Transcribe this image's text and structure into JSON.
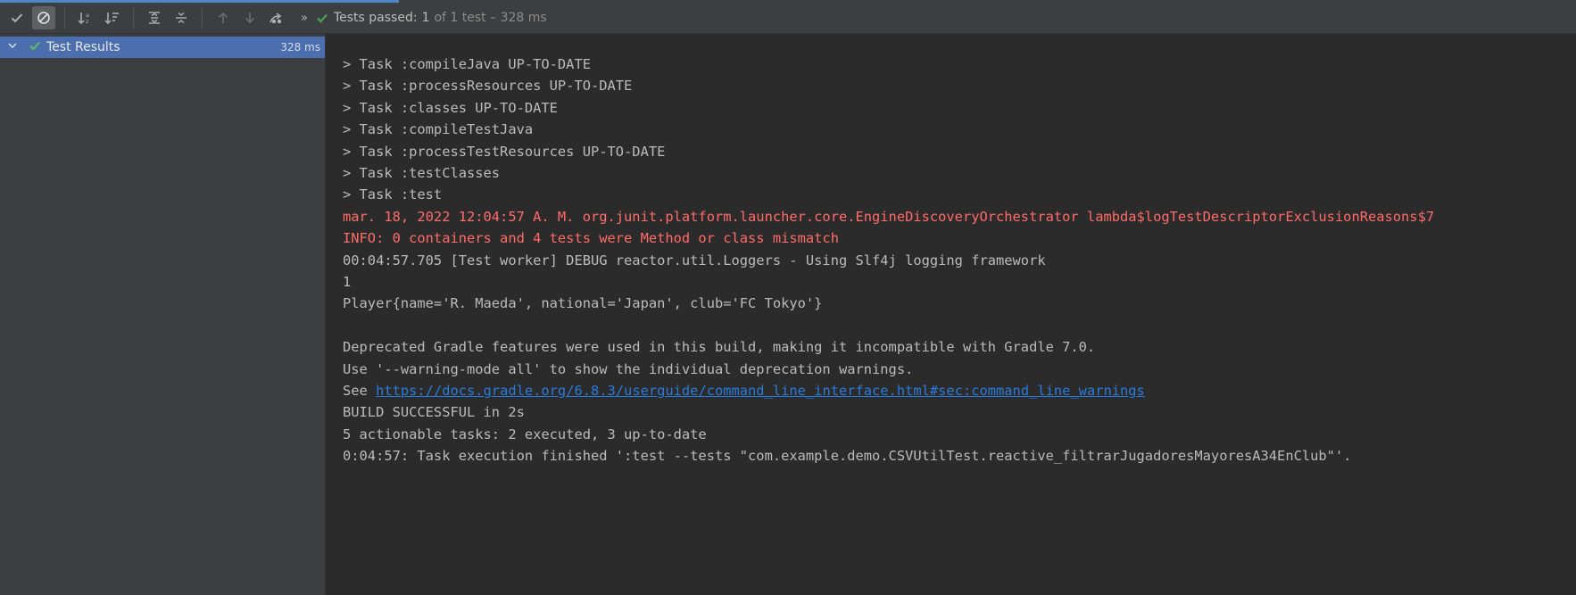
{
  "progress": {
    "fraction": 0.253
  },
  "toolbar": {
    "buttons": [
      {
        "icon": "show-passed-icon",
        "active": false
      },
      {
        "icon": "show-ignored-icon",
        "active": true
      },
      {
        "icon": "sort-alphabetically-icon",
        "active": false
      },
      {
        "icon": "sort-by-duration-icon",
        "active": false
      },
      {
        "icon": "expand-all-icon",
        "active": false
      },
      {
        "icon": "collapse-all-icon",
        "active": false
      },
      {
        "icon": "previous-failed-icon",
        "active": false
      },
      {
        "icon": "next-failed-icon",
        "active": false
      },
      {
        "icon": "export-test-results-icon",
        "active": false
      }
    ],
    "more_label": "»",
    "status_label": "Tests passed:",
    "status_count": "1",
    "status_detail": "of 1 test – 328 ms"
  },
  "tree": {
    "root_label": "Test Results",
    "root_time": "328 ms"
  },
  "console": {
    "lines": [
      {
        "text": "> Task :compileJava UP-TO-DATE",
        "type": "normal"
      },
      {
        "text": "> Task :processResources UP-TO-DATE",
        "type": "normal"
      },
      {
        "text": "> Task :classes UP-TO-DATE",
        "type": "normal"
      },
      {
        "text": "> Task :compileTestJava",
        "type": "normal"
      },
      {
        "text": "> Task :processTestResources UP-TO-DATE",
        "type": "normal"
      },
      {
        "text": "> Task :testClasses",
        "type": "normal"
      },
      {
        "text": "> Task :test",
        "type": "normal"
      },
      {
        "text": "mar. 18, 2022 12:04:57 A. M. org.junit.platform.launcher.core.EngineDiscoveryOrchestrator lambda$logTestDescriptorExclusionReasons$7",
        "type": "error"
      },
      {
        "text": "INFO: 0 containers and 4 tests were Method or class mismatch",
        "type": "error"
      },
      {
        "text": "00:04:57.705 [Test worker] DEBUG reactor.util.Loggers - Using Slf4j logging framework",
        "type": "normal"
      },
      {
        "text": "1",
        "type": "normal"
      },
      {
        "text": "Player{name='R. Maeda', national='Japan', club='FC Tokyo'}",
        "type": "normal"
      },
      {
        "text": "",
        "type": "normal"
      },
      {
        "text": "Deprecated Gradle features were used in this build, making it incompatible with Gradle 7.0.",
        "type": "normal"
      },
      {
        "text": "Use '--warning-mode all' to show the individual deprecation warnings.",
        "type": "normal"
      },
      {
        "text": "See ",
        "type": "link",
        "link": "https://docs.gradle.org/6.8.3/userguide/command_line_interface.html#sec:command_line_warnings"
      },
      {
        "text": "BUILD SUCCESSFUL in 2s",
        "type": "normal"
      },
      {
        "text": "5 actionable tasks: 2 executed, 3 up-to-date",
        "type": "normal"
      },
      {
        "text": "0:04:57: Task execution finished ':test --tests \"com.example.demo.CSVUtilTest.reactive_filtrarJugadoresMayoresA34EnClub\"'.",
        "type": "normal"
      }
    ]
  }
}
